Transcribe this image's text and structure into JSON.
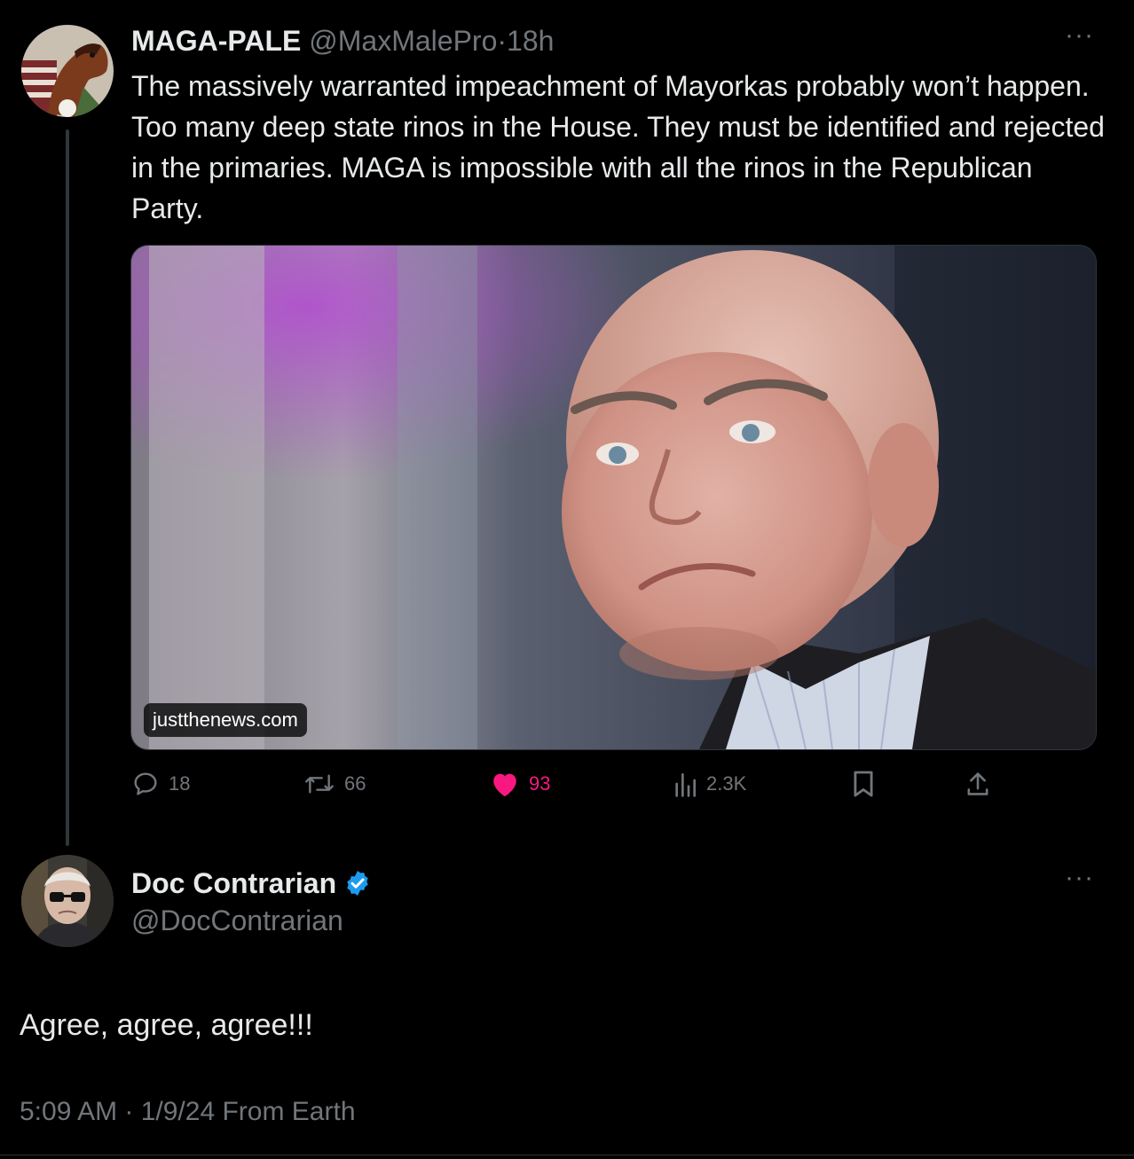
{
  "parent_tweet": {
    "display_name": "MAGA-PALE",
    "handle": "@MaxMalePro",
    "separator": "·",
    "time": "18h",
    "more": "···",
    "text": "The massively warranted impeachment of Mayorkas probably won’t happen. Too many deep state rinos in the House. They must be identified and rejected in the primaries. MAGA is impossible with all the rinos in the Republican Party.",
    "link_card": {
      "domain": "justthenews.com"
    },
    "actions": {
      "reply_count": "18",
      "retweet_count": "66",
      "like_count": "93",
      "views_count": "2.3K"
    },
    "icons": [
      "reply-icon",
      "retweet-icon",
      "heart-icon",
      "views-icon",
      "bookmark-icon",
      "share-icon"
    ]
  },
  "reply_tweet": {
    "display_name": "Doc Contrarian",
    "verified": true,
    "handle": "@DocContrarian",
    "more": "···",
    "text": "Agree, agree, agree!!!",
    "meta": "5:09 AM · 1/9/24 From Earth"
  },
  "colors": {
    "background": "#000000",
    "text_primary": "#e7e9ea",
    "text_secondary": "#71767b",
    "like_active": "#f91880",
    "verified_blue": "#1d9bf0",
    "divider": "#2f3336"
  }
}
